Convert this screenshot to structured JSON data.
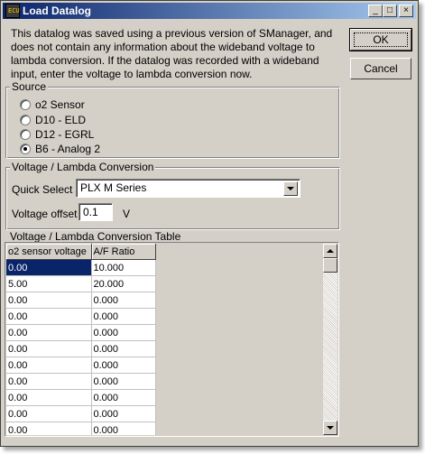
{
  "window": {
    "title": "Load Datalog",
    "app_icon_text": "ECU",
    "minimize_glyph": "_",
    "maximize_glyph": "□",
    "close_glyph": "×"
  },
  "description": "This datalog was saved using a previous version of SManager, and does not contain any information about the wideband voltage to lambda conversion.  If the datalog was recorded with a wideband input, enter the voltage to lambda conversion now.",
  "buttons": {
    "ok": "OK",
    "cancel": "Cancel"
  },
  "source": {
    "legend": "Source",
    "options": [
      {
        "label": "o2 Sensor",
        "selected": false
      },
      {
        "label": "D10 - ELD",
        "selected": false
      },
      {
        "label": "D12 - EGRL",
        "selected": false
      },
      {
        "label": "B6 - Analog 2",
        "selected": true
      }
    ]
  },
  "conversion": {
    "legend": "Voltage / Lambda Conversion",
    "quick_select_label": "Quick Select",
    "quick_select_value": "PLX M Series",
    "offset_label": "Voltage offset",
    "offset_value": "0.1",
    "offset_unit": "V"
  },
  "table": {
    "legend": "Voltage / Lambda Conversion Table",
    "columns": [
      "o2 sensor voltage",
      "A/F Ratio"
    ],
    "rows": [
      [
        "0.00",
        "10.000"
      ],
      [
        "5.00",
        "20.000"
      ],
      [
        "0.00",
        "0.000"
      ],
      [
        "0.00",
        "0.000"
      ],
      [
        "0.00",
        "0.000"
      ],
      [
        "0.00",
        "0.000"
      ],
      [
        "0.00",
        "0.000"
      ],
      [
        "0.00",
        "0.000"
      ],
      [
        "0.00",
        "0.000"
      ],
      [
        "0.00",
        "0.000"
      ],
      [
        "0.00",
        "0.000"
      ]
    ]
  },
  "colors": {
    "title_gradient_start": "#0a246a",
    "title_gradient_end": "#a6caf0",
    "face": "#d4d0c8",
    "selection": "#0a246a"
  }
}
